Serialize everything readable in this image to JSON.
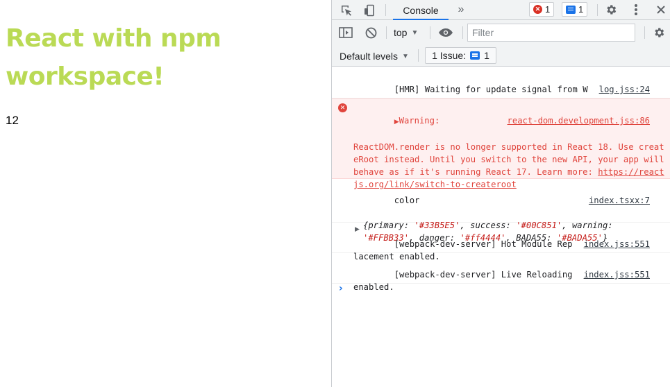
{
  "page": {
    "title": "React with npm workspace!",
    "count": "12",
    "title_color": "#BADA55"
  },
  "devtools": {
    "tabs": [
      {
        "label": "Console",
        "active": true
      }
    ],
    "more_tabs_icon": "chevron-double-right-icon",
    "error_count": "1",
    "message_count": "1",
    "context": "top",
    "filter_placeholder": "Filter",
    "log_levels": "Default levels",
    "issues_label": "1 Issue:",
    "issues_count": "1",
    "accent_color": "#1a73e8",
    "error_color": "#e0443c"
  },
  "console": {
    "messages": [
      {
        "type": "log",
        "text": "[HMR] Waiting for update signal from WDS...",
        "source": "log.jss:24"
      },
      {
        "type": "warning",
        "label": "Warning:",
        "text": "ReactDOM.render is no longer supported in React 18. Use createRoot instead. Until you switch to the new API, your app will behave as if it's running React 17. Learn more: ",
        "link": "https://reactjs.org/link/switch-to-createroot",
        "source": "react-dom.development.jss:86"
      },
      {
        "type": "log",
        "text": "color",
        "source": "index.tsxx:7",
        "object": {
          "open": "{",
          "entries": [
            {
              "key": "primary",
              "value": "'#33B5E5'"
            },
            {
              "key": "success",
              "value": "'#00C851'"
            },
            {
              "key": "warning",
              "value": "'#FFBB33'"
            },
            {
              "key": "danger",
              "value": "'#ff4444'"
            },
            {
              "key": "BADA55",
              "value": "'#BADA55'"
            }
          ],
          "close": "}"
        }
      },
      {
        "type": "log",
        "text": "[webpack-dev-server] Hot Module Replacement enabled.",
        "source": "index.jss:551"
      },
      {
        "type": "log",
        "text": "[webpack-dev-server] Live Reloading enabled.",
        "source": "index.jss:551"
      }
    ],
    "prompt": "›"
  }
}
